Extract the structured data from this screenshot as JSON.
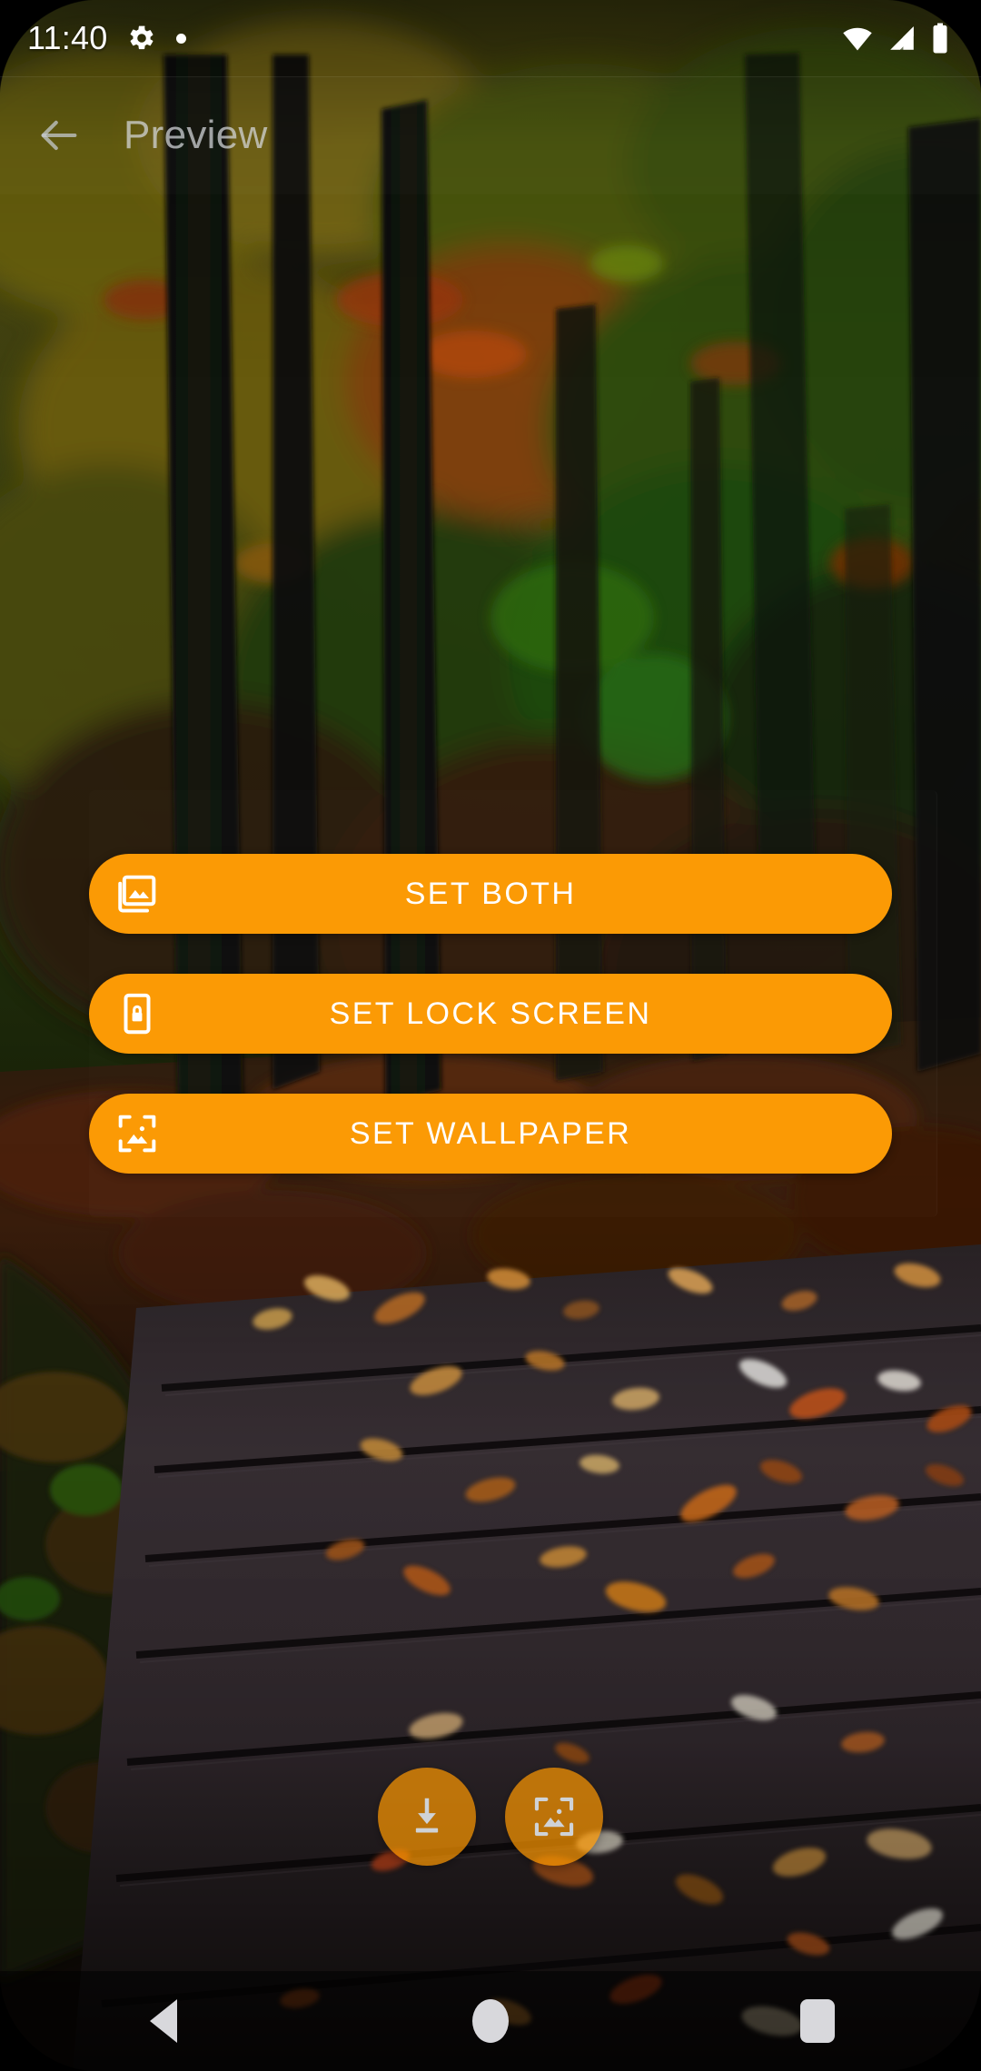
{
  "status_bar": {
    "time": "11:40",
    "icons": [
      "gear-icon",
      "notification-dot",
      "wifi-icon",
      "cellular-signal-icon",
      "battery-icon"
    ]
  },
  "toolbar": {
    "back_icon": "arrow-left-icon",
    "title": "Preview"
  },
  "actions": [
    {
      "id": "set-both",
      "label": "SET BOTH",
      "icon": "photo-library-icon"
    },
    {
      "id": "set-lock-screen",
      "label": "SET LOCK SCREEN",
      "icon": "phone-lock-icon"
    },
    {
      "id": "set-wallpaper",
      "label": "SET WALLPAPER",
      "icon": "wallpaper-frame-icon"
    }
  ],
  "fabs": [
    {
      "id": "download",
      "icon": "download-icon"
    },
    {
      "id": "preview-wallpaper",
      "icon": "wallpaper-frame-icon"
    }
  ],
  "navigation_bar": {
    "back": "back-triangle-icon",
    "home": "home-circle-icon",
    "recents": "recents-square-icon"
  },
  "colors": {
    "accent": "#FB9A05",
    "accent_fab": "#FF9900",
    "button_text": "#FFFFFF",
    "toolbar_title": "#D7DADE",
    "nav_icon": "#D8D8DC"
  },
  "wallpaper": {
    "description": "Autumn forest boardwalk covered with fallen leaves"
  }
}
